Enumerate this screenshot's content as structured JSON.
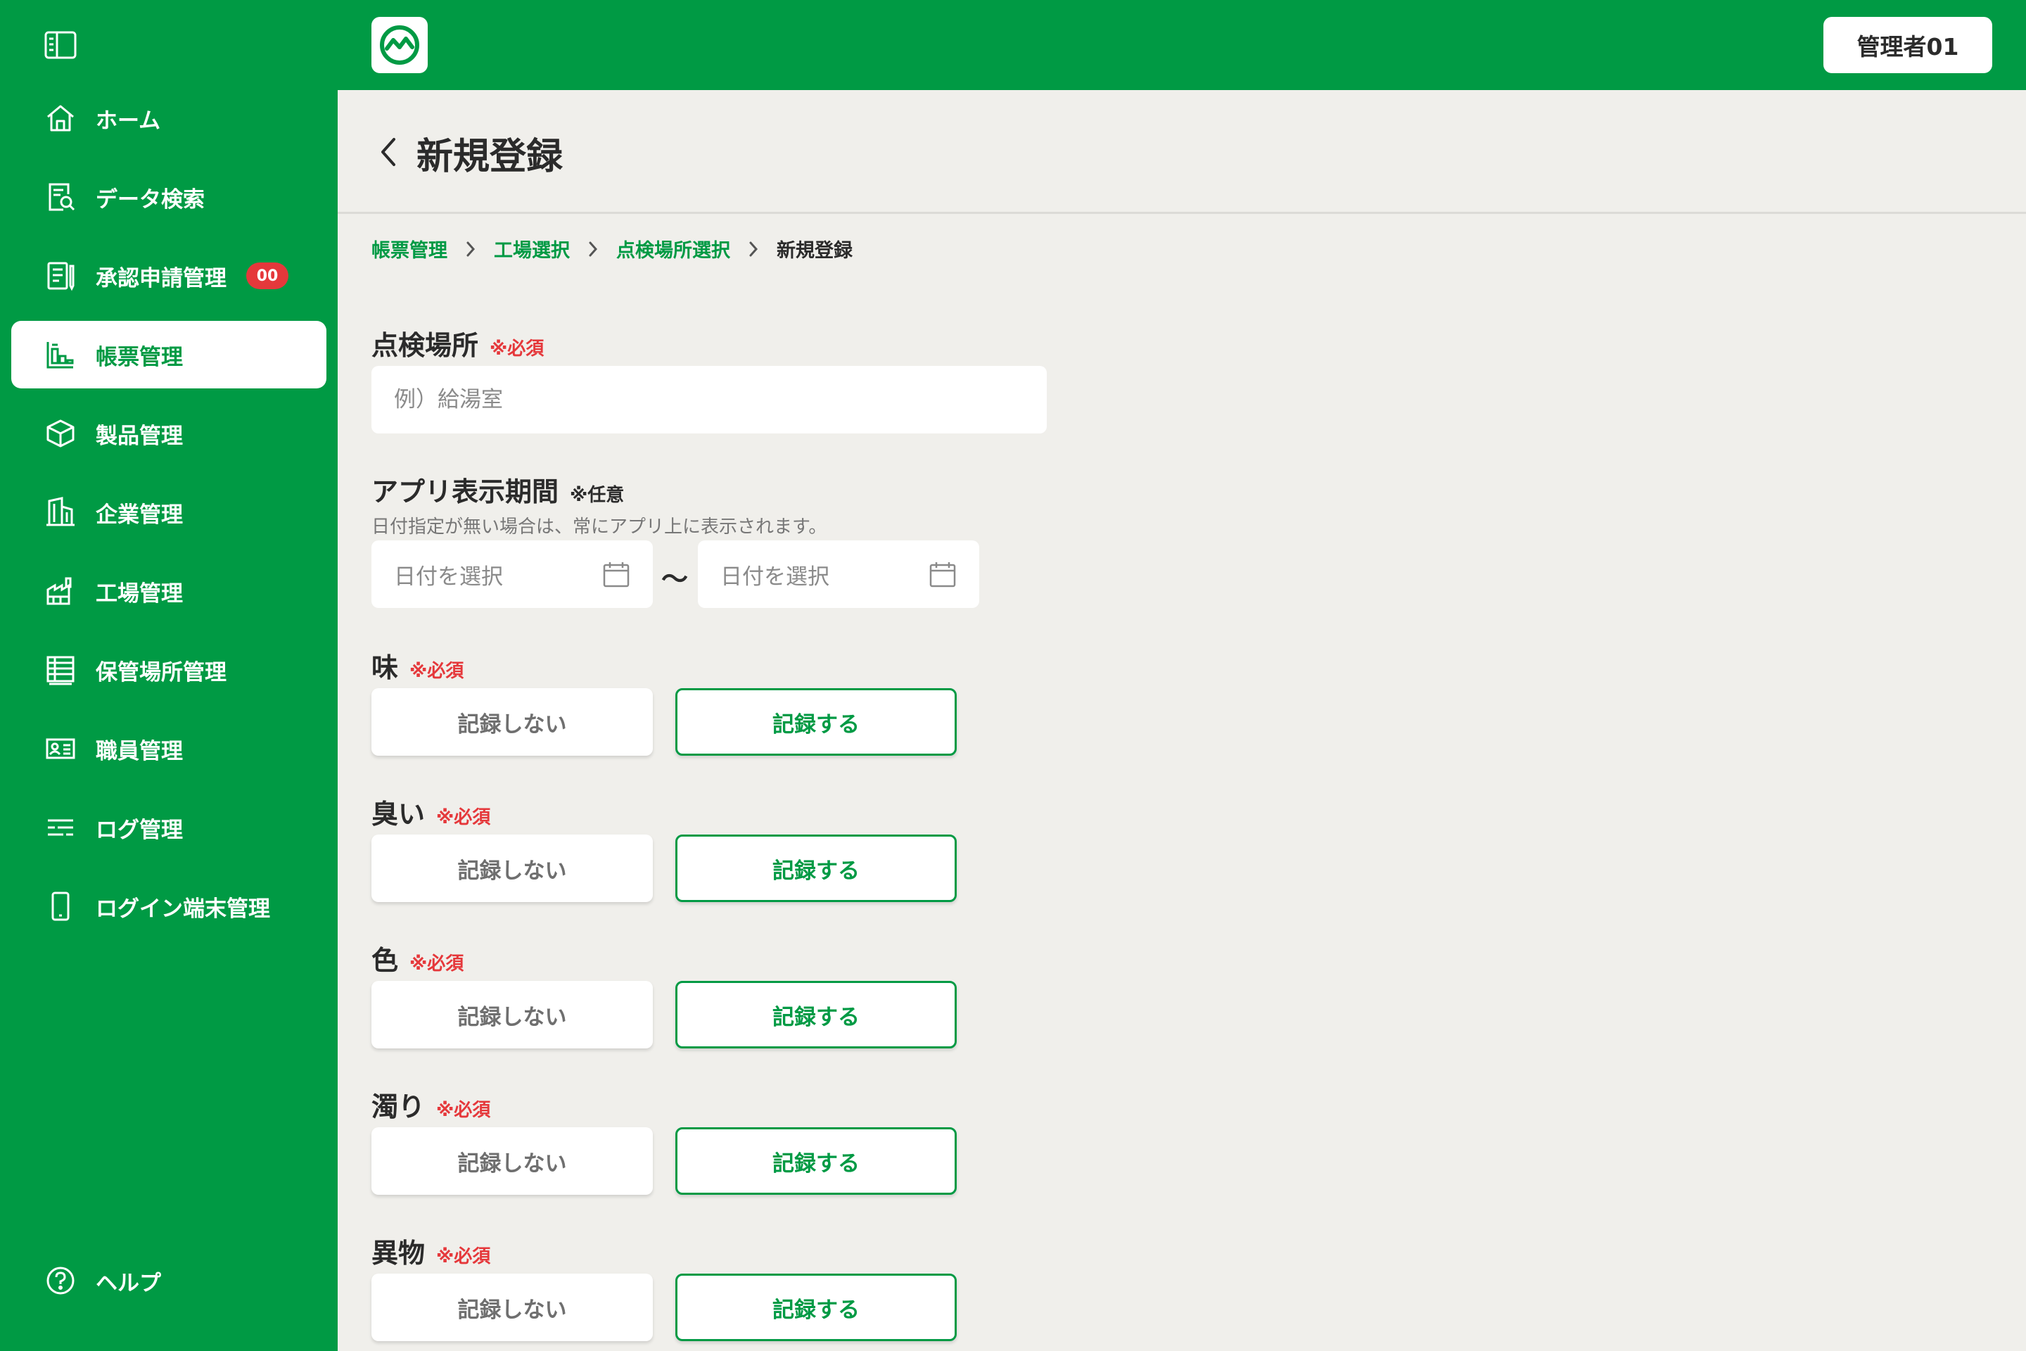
{
  "sidebar": {
    "items": [
      {
        "label": "ホーム",
        "icon": "home-icon"
      },
      {
        "label": "データ検索",
        "icon": "data-search-icon"
      },
      {
        "label": "承認申請管理",
        "icon": "approval-icon",
        "badge": "00"
      },
      {
        "label": "帳票管理",
        "icon": "report-icon",
        "active": true
      },
      {
        "label": "製品管理",
        "icon": "box-icon"
      },
      {
        "label": "企業管理",
        "icon": "building-icon"
      },
      {
        "label": "工場管理",
        "icon": "factory-icon"
      },
      {
        "label": "保管場所管理",
        "icon": "storage-icon"
      },
      {
        "label": "職員管理",
        "icon": "id-card-icon"
      },
      {
        "label": "ログ管理",
        "icon": "log-icon"
      },
      {
        "label": "ログイン端末管理",
        "icon": "device-icon"
      }
    ],
    "help_label": "ヘルプ"
  },
  "header": {
    "user_label": "管理者01"
  },
  "page": {
    "title": "新規登録"
  },
  "breadcrumb": [
    "帳票管理",
    "工場選択",
    "点検場所選択",
    "新規登録"
  ],
  "form": {
    "location": {
      "label": "点検場所",
      "required": "※必須",
      "placeholder": "例）給湯室"
    },
    "period": {
      "label": "アプリ表示期間",
      "optional": "※任意",
      "hint": "日付指定が無い場合は、常にアプリ上に表示されます。",
      "start_placeholder": "日付を選択",
      "separator": "〜",
      "end_placeholder": "日付を選択"
    },
    "toggles": [
      {
        "label": "味",
        "required": "※必須",
        "off_label": "記録しない",
        "on_label": "記録する"
      },
      {
        "label": "臭い",
        "required": "※必須",
        "off_label": "記録しない",
        "on_label": "記録する"
      },
      {
        "label": "色",
        "required": "※必須",
        "off_label": "記録しない",
        "on_label": "記録する"
      },
      {
        "label": "濁り",
        "required": "※必須",
        "off_label": "記録しない",
        "on_label": "記録する"
      },
      {
        "label": "異物",
        "required": "※必須",
        "off_label": "記録しない",
        "on_label": "記録する"
      }
    ]
  },
  "colors": {
    "brand_green": "#009a44",
    "required_red": "#e5383b",
    "background": "#f0efeb"
  }
}
